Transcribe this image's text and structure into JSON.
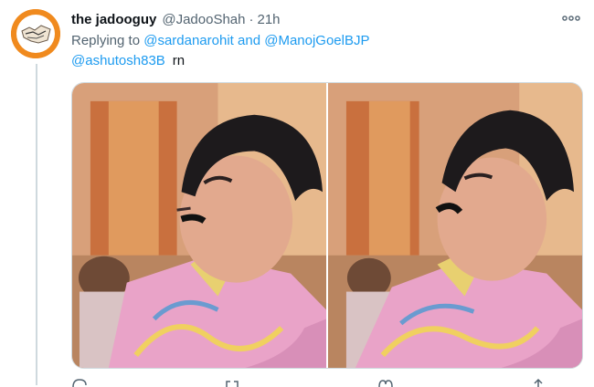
{
  "tweet": {
    "display_name": "the jadooguy",
    "handle": "@JadooShah",
    "separator": "·",
    "time": "21h",
    "replying_prefix": "Replying to",
    "reply_mentions": [
      "@sardanarohit",
      "and",
      "@ManojGoelBJP"
    ],
    "text_mention": "@ashutosh83B",
    "text_body": "rn"
  },
  "icons": {
    "avatar": "avatar",
    "more": "more-icon",
    "reply": "reply-icon",
    "retweet": "retweet-icon",
    "like": "like-icon",
    "share": "share-icon"
  },
  "colors": {
    "link": "#1d9bf0",
    "secondary": "#536471",
    "avatar_bg": "#f08a1e"
  }
}
